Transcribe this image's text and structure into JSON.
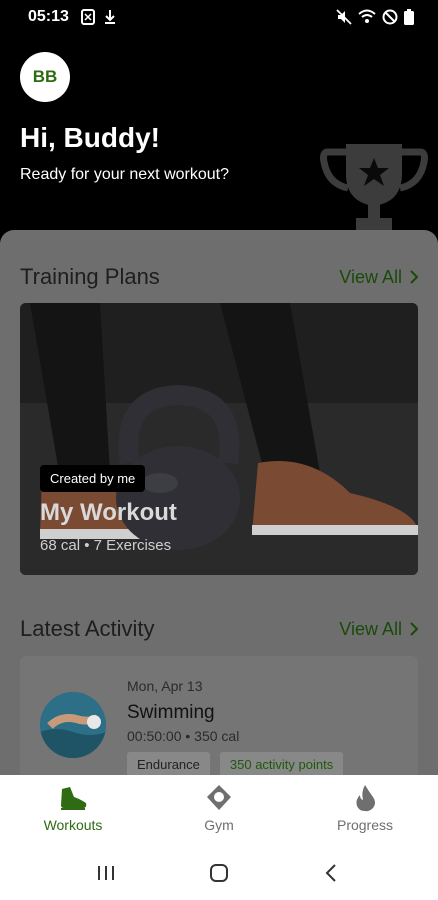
{
  "status_bar": {
    "time": "05:13"
  },
  "header": {
    "avatar_initials": "BB",
    "greeting": "Hi, Buddy!",
    "subtitle": "Ready for your next workout?"
  },
  "training_plans": {
    "title": "Training Plans",
    "view_all": "View All",
    "card": {
      "badge": "Created by me",
      "name": "My Workout",
      "meta": "68 cal • 7 Exercises"
    }
  },
  "latest_activity": {
    "title": "Latest Activity",
    "view_all": "View All",
    "item": {
      "date": "Mon, Apr 13",
      "name": "Swimming",
      "meta": "00:50:00 • 350 cal",
      "tags": [
        "Endurance",
        "350 activity points"
      ]
    }
  },
  "bottom_nav": {
    "items": [
      {
        "label": "Workouts",
        "icon": "shoe-icon",
        "active": true
      },
      {
        "label": "Gym",
        "icon": "location-pin-icon",
        "active": false
      },
      {
        "label": "Progress",
        "icon": "flame-icon",
        "active": false
      }
    ]
  },
  "colors": {
    "accent": "#2e6b13",
    "overlay": "#6e6e6e"
  }
}
